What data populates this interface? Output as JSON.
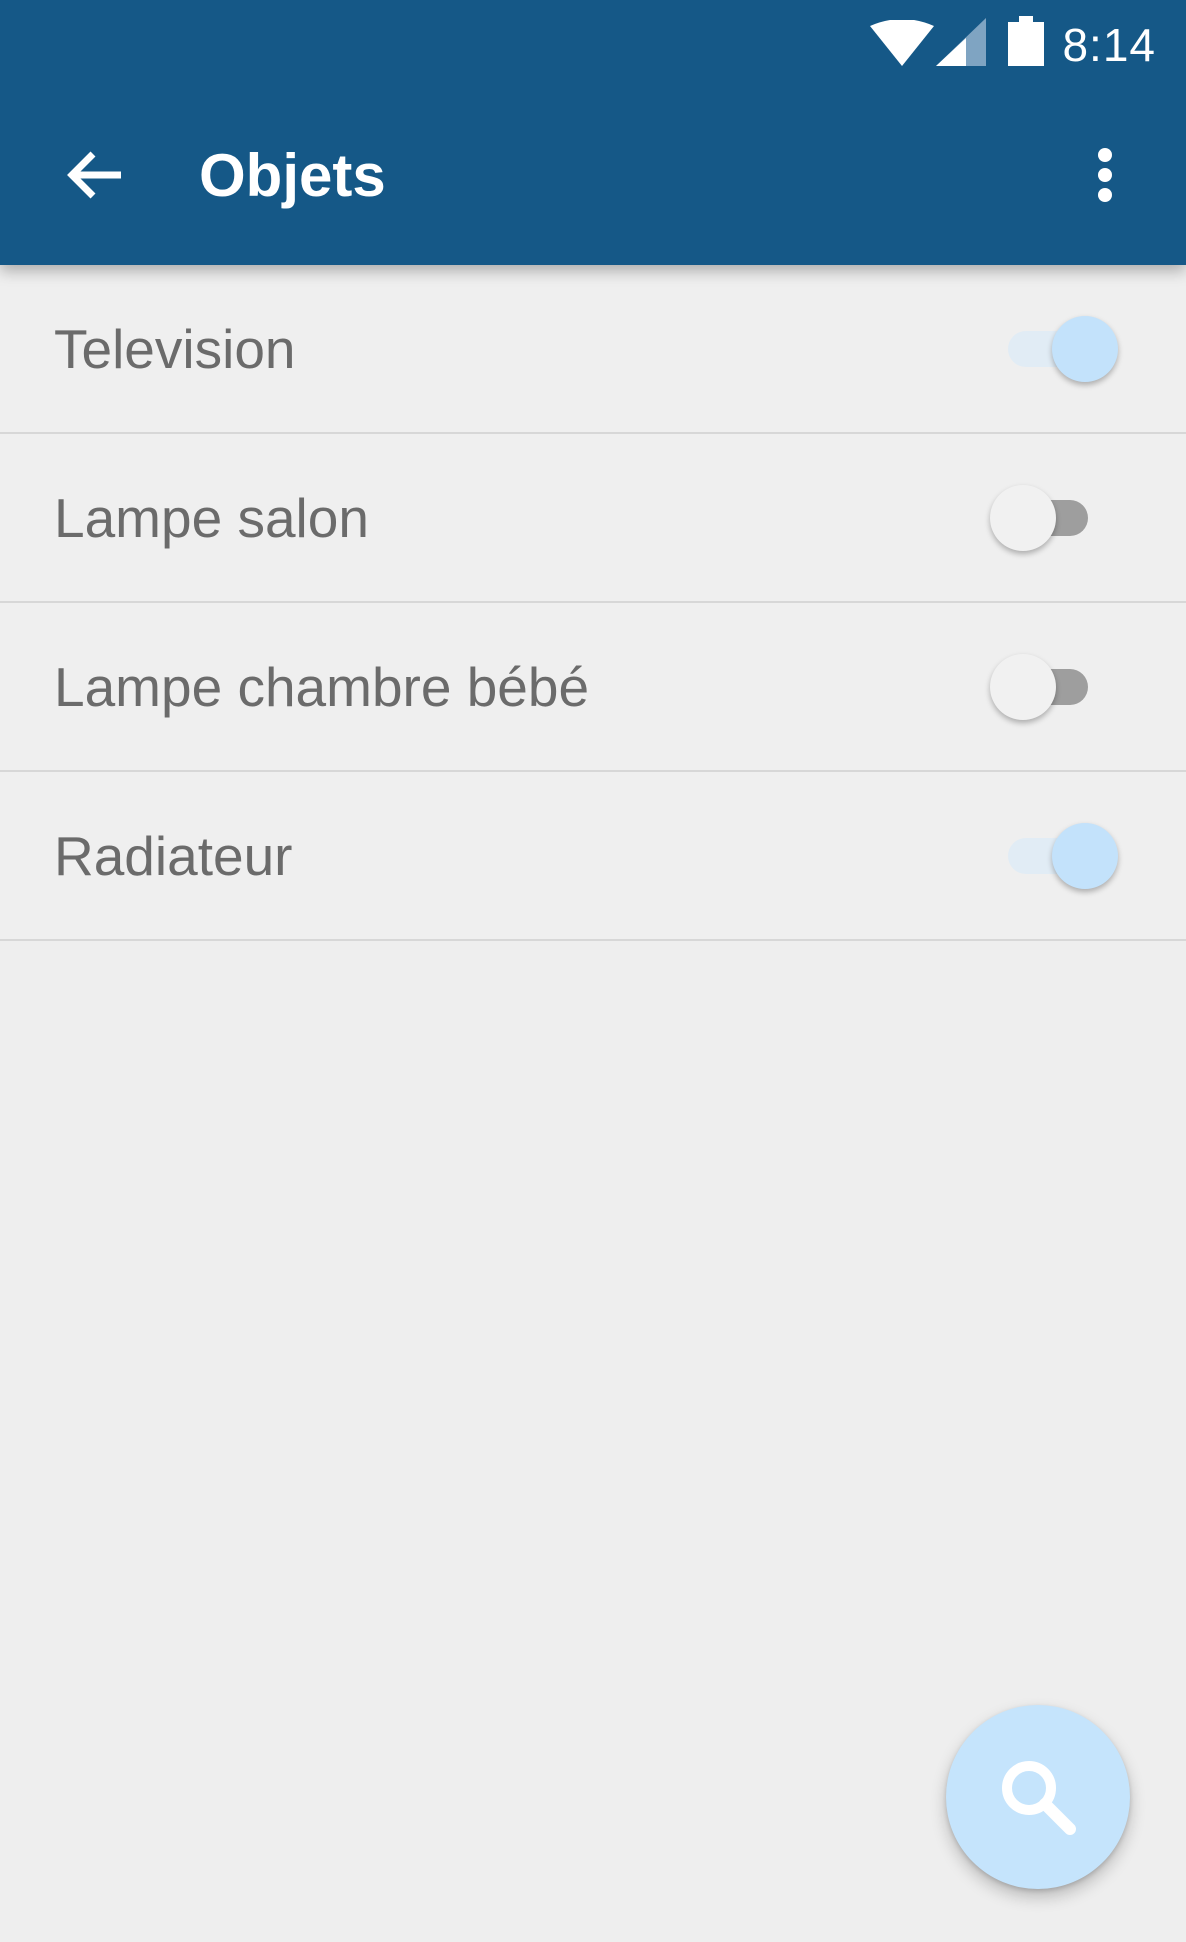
{
  "status_bar": {
    "time": "8:14",
    "icons": [
      "wifi-icon",
      "signal-icon",
      "battery-icon"
    ]
  },
  "toolbar": {
    "title": "Objets",
    "back_icon": "arrow-left-icon",
    "menu_icon": "more-vertical-icon"
  },
  "items": [
    {
      "label": "Television",
      "enabled": true
    },
    {
      "label": "Lampe salon",
      "enabled": false
    },
    {
      "label": "Lampe chambre bébé",
      "enabled": false
    },
    {
      "label": "Radiateur",
      "enabled": true
    }
  ],
  "fab": {
    "icon": "search-icon"
  },
  "colors": {
    "primary": "#155887",
    "background": "#eeeeee",
    "toggle_on_thumb": "#c3e2fb",
    "toggle_on_track": "#e1ecf5",
    "toggle_off_thumb": "#f1f1f1",
    "toggle_off_track": "#9e9e9e",
    "fab": "#c5e4fc",
    "label_text": "#6b6b6b"
  }
}
